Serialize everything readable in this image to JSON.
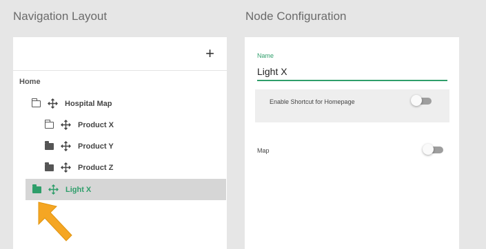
{
  "nav": {
    "title": "Navigation Layout",
    "add_icon": "+",
    "home_label": "Home",
    "items": [
      {
        "label": "Hospital Map",
        "folder": "outline"
      },
      {
        "label": "Product X",
        "folder": "outline"
      },
      {
        "label": "Product Y",
        "folder": "solid"
      },
      {
        "label": "Product Z",
        "folder": "solid"
      },
      {
        "label": "Light X",
        "folder": "solid",
        "selected": true
      }
    ]
  },
  "config": {
    "title": "Node Configuration",
    "name_label": "Name",
    "name_value": "Light X",
    "shortcut_label": "Enable Shortcut for Homepage",
    "shortcut_enabled": false,
    "map_label": "Map",
    "map_enabled": false
  },
  "colors": {
    "accent": "#2e9e6a",
    "cursor": "#f5a623"
  }
}
